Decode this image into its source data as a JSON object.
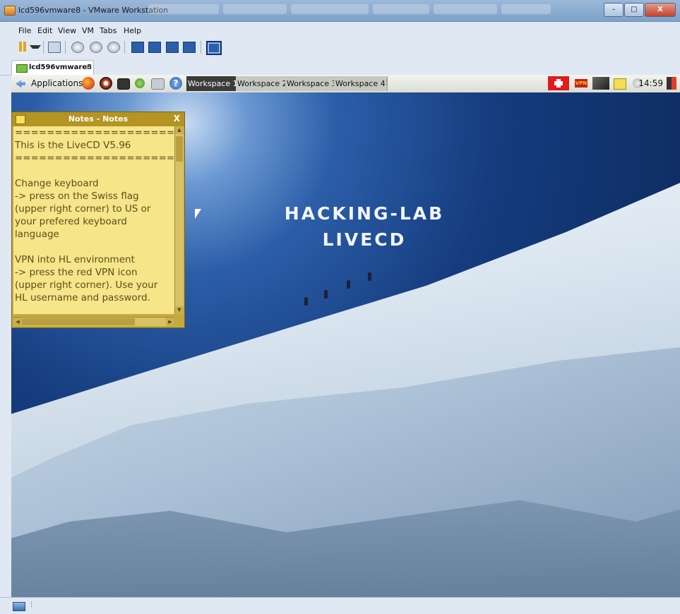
{
  "window": {
    "title": "lcd596vmware8 - VMware Workstation",
    "controls": {
      "minimize": "–",
      "maximize": "□",
      "close": "X"
    }
  },
  "menu": [
    "File",
    "Edit",
    "View",
    "VM",
    "Tabs",
    "Help"
  ],
  "toolbar": {
    "icons": [
      "pause-icon",
      "dropdown-arrow-icon",
      "send-keys-icon",
      "snapshot-icon",
      "revert-snapshot-icon",
      "snapshot-manager-icon",
      "library-view-icon",
      "thumbnail-bar-icon",
      "full-screen-icon",
      "unity-icon",
      "console-view-icon"
    ]
  },
  "vm_tab": {
    "label": "lcd596vmware8",
    "close": "×"
  },
  "guest_panel": {
    "applications_label": "Applications",
    "launchers": [
      "firefox-icon",
      "burp-icon",
      "terminal-icon",
      "network-tool-icon",
      "network-places-icon",
      "help-icon"
    ],
    "workspaces": [
      "Workspace 1",
      "Workspace 2",
      "Workspace 3",
      "Workspace 4"
    ],
    "handle": "⋮",
    "tray": [
      "swiss-flag-icon",
      "vpn-icon",
      "network-icon",
      "notes-icon",
      "volume-icon"
    ],
    "clock": "14:59",
    "logout_icon": "logout-icon"
  },
  "wallpaper": {
    "headline_line1": "HACKING-LAB",
    "headline_line2": "LIVECD"
  },
  "notes_window": {
    "title": "Notes - Notes",
    "close": "X",
    "lines": [
      "====================",
      "This is the LiveCD V5.96",
      "====================",
      "",
      "Change keyboard",
      "-> press on the Swiss flag",
      "(upper right corner) to US or",
      "your prefered keyboard",
      "language",
      "",
      "VPN into HL environment",
      "-> press the red VPN icon",
      "(upper right corner). Use your",
      "HL username and password."
    ]
  },
  "statusbar": {
    "handle": "⋮"
  },
  "colors": {
    "notes_bg": "#f6e589",
    "notes_title": "#b49422",
    "sky": "#153c7e",
    "active_workspace": "#3b3b3b"
  }
}
